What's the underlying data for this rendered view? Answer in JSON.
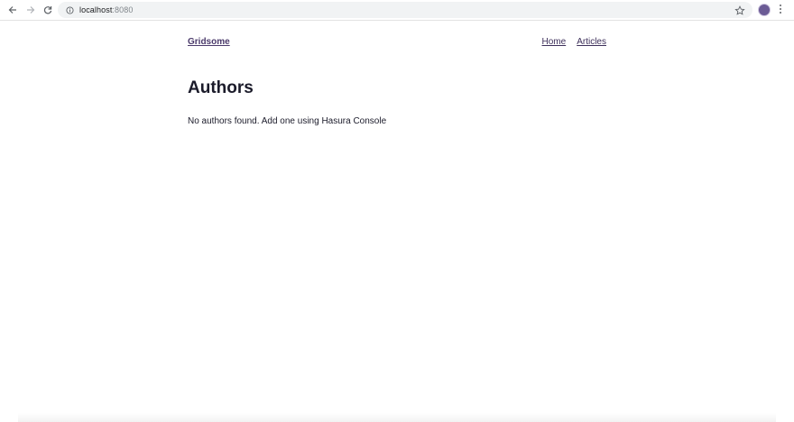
{
  "browser": {
    "url_host": "localhost",
    "url_port": ":8080"
  },
  "site": {
    "logo": "Gridsome",
    "nav": [
      {
        "label": "Home"
      },
      {
        "label": "Articles"
      }
    ]
  },
  "main": {
    "title": "Authors",
    "empty_message": "No authors found. Add one using Hasura Console"
  }
}
